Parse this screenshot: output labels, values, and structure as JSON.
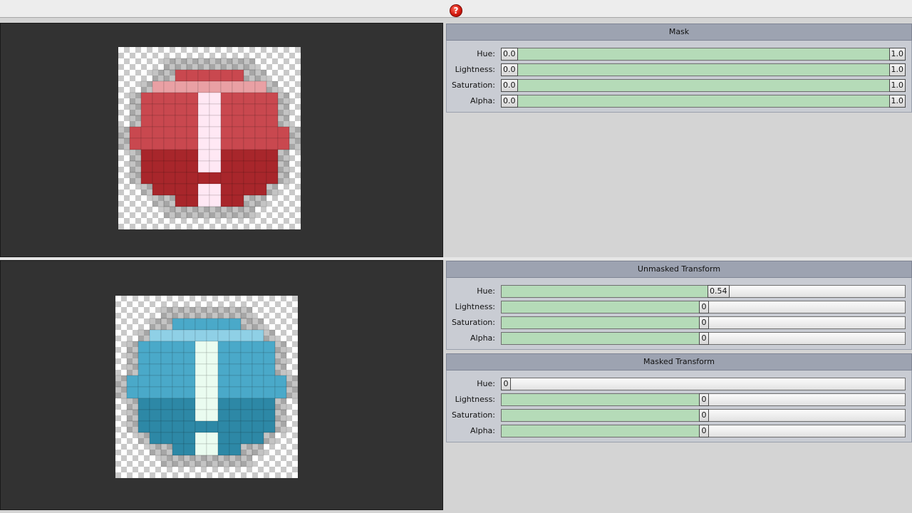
{
  "toolbar": {
    "help_icon": "question-mark-icon",
    "help_glyph": "?"
  },
  "mask": {
    "title": "Mask",
    "rows": [
      {
        "label": "Hue:",
        "min": "0.0",
        "max": "1.0"
      },
      {
        "label": "Lightness:",
        "min": "0.0",
        "max": "1.0"
      },
      {
        "label": "Saturation:",
        "min": "0.0",
        "max": "1.0"
      },
      {
        "label": "Alpha:",
        "min": "0.0",
        "max": "1.0"
      }
    ]
  },
  "unmasked": {
    "title": "Unmasked Transform",
    "rows": [
      {
        "label": "Hue:",
        "value": "0.54",
        "fraction": 0.51
      },
      {
        "label": "Lightness:",
        "value": "0",
        "fraction": 0.49
      },
      {
        "label": "Saturation:",
        "value": "0",
        "fraction": 0.49
      },
      {
        "label": "Alpha:",
        "value": "0",
        "fraction": 0.49
      }
    ]
  },
  "masked": {
    "title": "Masked Transform",
    "rows": [
      {
        "label": "Hue:",
        "value": "0",
        "fraction": 0.0
      },
      {
        "label": "Lightness:",
        "value": "0",
        "fraction": 0.49
      },
      {
        "label": "Saturation:",
        "value": "0",
        "fraction": 0.49
      },
      {
        "label": "Alpha:",
        "value": "0",
        "fraction": 0.49
      }
    ]
  },
  "colors": {
    "original_dark": "#a8262b",
    "original_mid": "#c9484f",
    "original_light": "#e9a0a4",
    "original_glyph": "#ffe8f4",
    "transformed_dark": "#2d88a6",
    "transformed_mid": "#4aa9c9",
    "transformed_light": "#8fd0e6",
    "transformed_glyph": "#eafcf0",
    "slider_fill": "#b5dbb8"
  }
}
